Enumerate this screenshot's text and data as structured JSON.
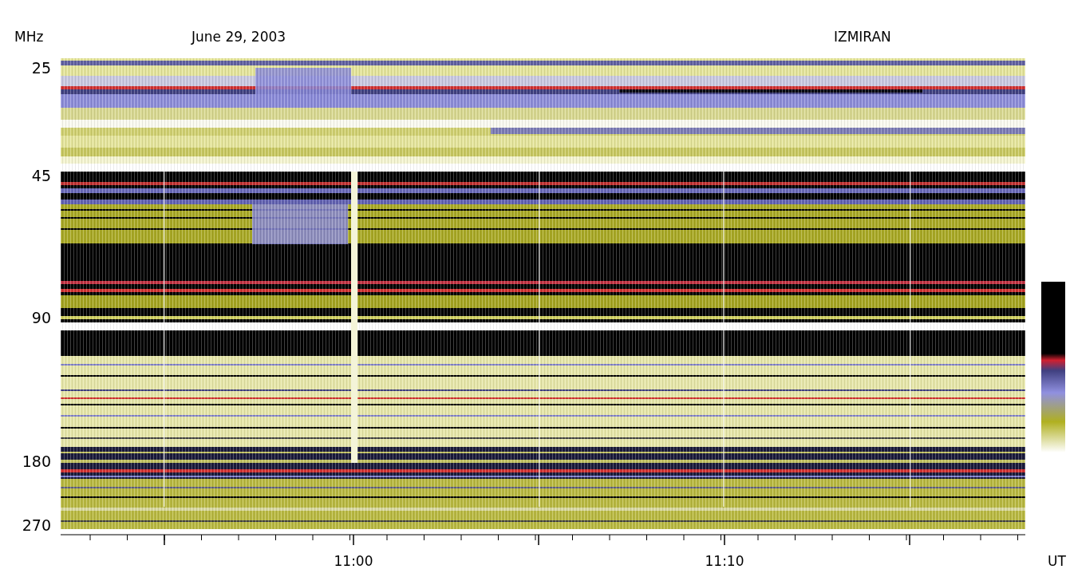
{
  "header": {
    "y_unit": "MHz",
    "date": "June 29, 2003",
    "station": "IZMIRAN"
  },
  "y_axis": {
    "ticks": [
      "25",
      "45",
      "90",
      "180",
      "270"
    ]
  },
  "x_axis": {
    "ticks": [
      "11:00",
      "11:10"
    ],
    "unit": "UT"
  }
}
